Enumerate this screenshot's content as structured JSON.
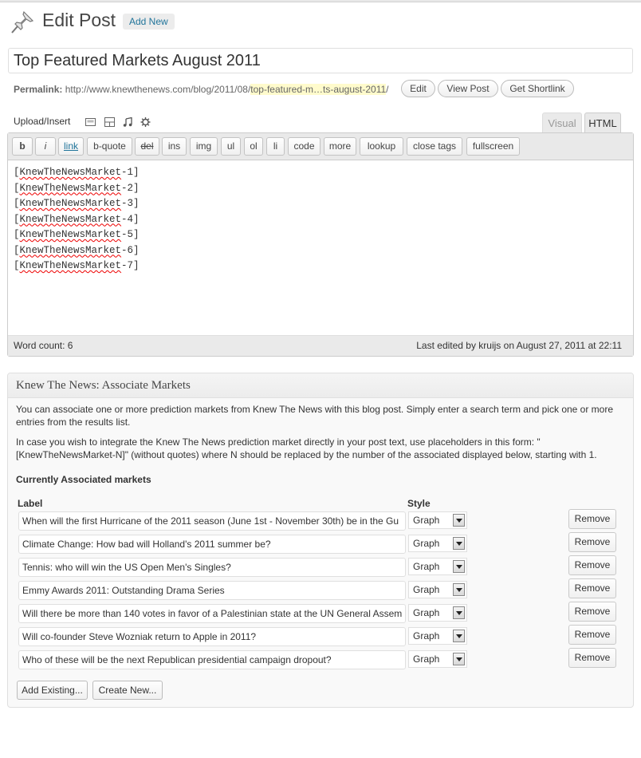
{
  "header": {
    "title": "Edit Post",
    "add_new": "Add New"
  },
  "post": {
    "title": "Top Featured Markets August 2011"
  },
  "permalink": {
    "label": "Permalink:",
    "url_base": "http://www.knewthenews.com/blog/2011/08/",
    "slug": "top-featured-m…ts-august-2011",
    "trailing": "/",
    "buttons": {
      "edit": "Edit",
      "view": "View Post",
      "shortlink": "Get Shortlink"
    }
  },
  "upload_insert": {
    "label": "Upload/Insert",
    "icons": [
      "add-image-icon",
      "add-gallery-icon",
      "add-audio-icon",
      "add-media-icon"
    ]
  },
  "editor_tabs": {
    "visual": "Visual",
    "html": "HTML",
    "active": "HTML"
  },
  "quicktags": [
    "b",
    "i",
    "link",
    "b-quote",
    "del",
    "ins",
    "img",
    "ul",
    "ol",
    "li",
    "code",
    "more",
    "lookup",
    "close tags",
    "fullscreen"
  ],
  "content_lines": [
    {
      "open": "[",
      "word": "KnewTheNewsMarket",
      "rest": "-1]"
    },
    {
      "open": "[",
      "word": "KnewTheNewsMarket",
      "rest": "-2]"
    },
    {
      "open": "[",
      "word": "KnewTheNewsMarket",
      "rest": "-3]"
    },
    {
      "open": "[",
      "word": "KnewTheNewsMarket",
      "rest": "-4]"
    },
    {
      "open": "[",
      "word": "KnewTheNewsMarket",
      "rest": "-5]"
    },
    {
      "open": "[",
      "word": "KnewTheNewsMarket",
      "rest": "-6]"
    },
    {
      "open": "[",
      "word": "KnewTheNewsMarket",
      "rest": "-7]"
    }
  ],
  "status": {
    "word_count": "Word count: 6",
    "last_edited": "Last edited by kruijs on August 27, 2011 at 22:11"
  },
  "metabox": {
    "title": "Knew The News: Associate Markets",
    "intro": "You can associate one or more prediction markets from Knew The News with this blog post. Simply enter a search term and pick one or more entries from the results list.",
    "placeholder_info": "In case you wish to integrate the Knew The News prediction market directly in your post text, use placeholders in this form: \"[KnewTheNewsMarket-N]\" (without quotes) where N should be replaced by the number of the associated displayed below, starting with 1.",
    "currently_label": "Currently Associated markets",
    "col_label": "Label",
    "col_style": "Style",
    "remove_label": "Remove",
    "markets": [
      {
        "label": "When will the first Hurricane of the 2011 season (June 1st - November 30th) be in the Gu",
        "style": "Graph"
      },
      {
        "label": "Climate Change: How bad will Holland's 2011 summer be?",
        "style": "Graph"
      },
      {
        "label": "Tennis: who will win the US Open Men's Singles?",
        "style": "Graph"
      },
      {
        "label": "Emmy Awards 2011: Outstanding Drama Series",
        "style": "Graph"
      },
      {
        "label": "Will there be more than 140 votes in favor of a Palestinian state at the UN General Assem",
        "style": "Graph"
      },
      {
        "label": "Will co-founder Steve Wozniak return to Apple in 2011?",
        "style": "Graph"
      },
      {
        "label": "Who of these will be the next Republican presidential campaign dropout?",
        "style": "Graph"
      }
    ],
    "add_existing": "Add Existing...",
    "create_new": "Create New..."
  }
}
